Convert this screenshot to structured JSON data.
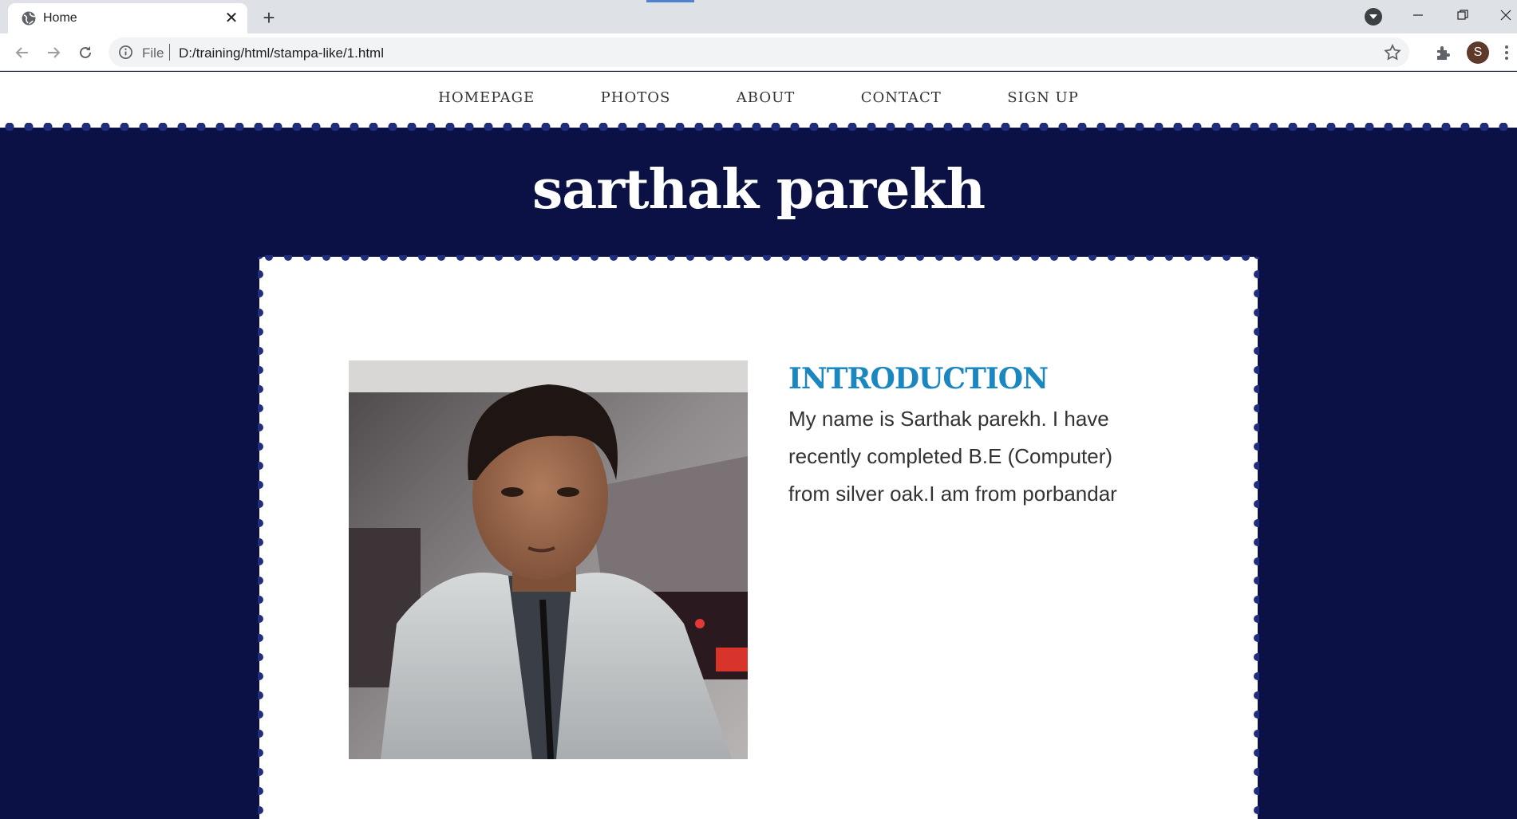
{
  "browser": {
    "tab_title": "Home",
    "file_label": "File",
    "url": "D:/training/html/stampa-like/1.html",
    "profile_initial": "S",
    "icons": [
      "globe-icon",
      "close-icon",
      "plus-icon",
      "back-arrow-icon",
      "forward-arrow-icon",
      "reload-icon",
      "info-icon",
      "star-icon",
      "puzzle-extension-icon",
      "more-vert-icon",
      "minimize-icon",
      "restore-icon",
      "window-close-icon"
    ]
  },
  "site": {
    "nav": [
      "HOMEPAGE",
      "PHOTOS",
      "ABOUT",
      "CONTACT",
      "SIGN UP"
    ],
    "title": "sarthak parekh",
    "intro": {
      "heading": "INTRODUCTION",
      "text": "My name is Sarthak parekh. I have recently completed B.E (Computer) from silver oak.I am from porbandar"
    }
  },
  "colors": {
    "page_background": "#0b1145",
    "scallop": "#1f2d7a",
    "heading_blue": "#1a87c0",
    "card": "#ffffff"
  }
}
